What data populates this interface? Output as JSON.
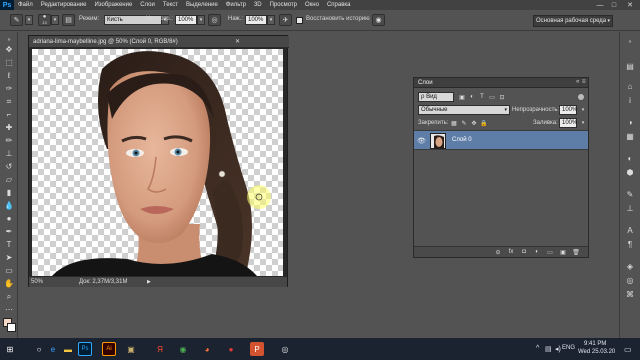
{
  "app": {
    "logo": "Ps",
    "menus": [
      "Файл",
      "Редактирование",
      "Изображение",
      "Слои",
      "Текст",
      "Выделение",
      "Фильтр",
      "3D",
      "Просмотр",
      "Окно",
      "Справка"
    ],
    "window_controls": [
      "—",
      "□",
      "✕"
    ]
  },
  "options_bar": {
    "brush_size": "13",
    "mode_label": "Режим:",
    "mode_value": "Кисть",
    "opacity_label": "Непрозр.:",
    "opacity_value": "100%",
    "pressure_label": "Наж.:",
    "pressure_value": "100%",
    "history_label": "Восстановить историю",
    "workspace": "Основная рабочая среда"
  },
  "document": {
    "tab_title": "adriana-lima-maybelline.jpg @ 50% (Слой 0, RGB/8#)",
    "close_symbol": "✕",
    "zoom": "50%",
    "doc_info": "Док: 2,37M/3,31M",
    "arrow": "▶"
  },
  "layers_panel": {
    "title": "Слои",
    "menu_icon": "≡",
    "close_symbol": "«",
    "filter_kind": "ρ Вид",
    "blend_mode": "Обычные",
    "opacity_label": "Непрозрачность:",
    "opacity_value": "100%",
    "lock_label": "Закрепить:",
    "fill_label": "Заливка:",
    "fill_value": "100%",
    "layer_name": "Слой 0",
    "footer_icons": [
      "link-icon",
      "fx-icon",
      "mask-icon",
      "adjustment-icon",
      "folder-icon",
      "new-layer-icon",
      "trash-icon"
    ],
    "footer_glyphs": [
      "⊝",
      "fx",
      "◘",
      "◐",
      "▭",
      "▣",
      "🗑"
    ]
  },
  "taskbar": {
    "time": "9:41 PM",
    "date": "Wed 25.03.20",
    "lang": "ENG",
    "apps": [
      {
        "name": "windows-start-icon",
        "glyph": "⊞",
        "color": "#ffffff"
      },
      {
        "name": "search-icon",
        "glyph": "○",
        "color": "#ffffff"
      },
      {
        "name": "edge-icon",
        "glyph": "e",
        "color": "#3aa0ff"
      },
      {
        "name": "file-explorer-icon",
        "glyph": "▬",
        "color": "#f5c542"
      },
      {
        "name": "photoshop-taskbar-icon",
        "glyph": "Ps",
        "color": "#31a8ff"
      },
      {
        "name": "illustrator-icon",
        "glyph": "Ai",
        "color": "#ff9a00"
      },
      {
        "name": "store-icon",
        "glyph": "▣",
        "color": "#c9b06b"
      },
      {
        "name": "yandex-icon",
        "glyph": "Я",
        "color": "#ff4a2d"
      },
      {
        "name": "chrome-icon",
        "glyph": "◉",
        "color": "#4caf50"
      },
      {
        "name": "firefox-icon",
        "glyph": "◕",
        "color": "#ff7139"
      },
      {
        "name": "record-icon",
        "glyph": "●",
        "color": "#e53935"
      },
      {
        "name": "powerpoint-icon",
        "glyph": "P",
        "color": "#d35230"
      },
      {
        "name": "media-icon",
        "glyph": "◎",
        "color": "#e0e0e0"
      }
    ]
  },
  "colors": {
    "accent_layer": "#5e7ea8",
    "foreground": "#f6d8c8",
    "background": "#ffffff"
  }
}
